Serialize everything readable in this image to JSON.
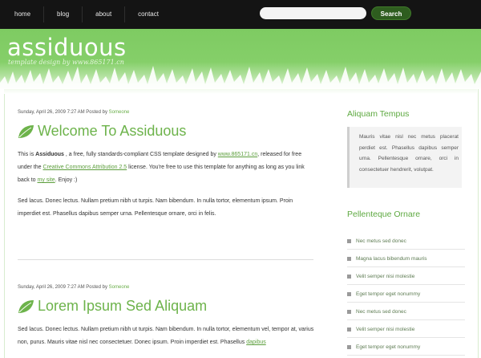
{
  "nav": {
    "items": [
      "home",
      "blog",
      "about",
      "contact"
    ]
  },
  "search": {
    "value": "",
    "button_label": "Search"
  },
  "header": {
    "title": "assiduous",
    "tagline": "template design by www.865171.cn"
  },
  "posts": [
    {
      "date": "Sunday, April 26, 2009 7:27 AM",
      "posted_by_label": "Posted by",
      "author": "Someone",
      "title": "Welcome To Assiduous",
      "p1": {
        "t1": "This is ",
        "bold": "Assiduous",
        "t2": " , a free, fully standards-compliant CSS template designed by ",
        "link1": "www.865171.cn",
        "t3": ", released for free under the ",
        "link2": "Creative Commons Attribution 2.5",
        "t4": " license. You're free to use this template for anything as long as you link back to ",
        "link3": "my site",
        "t5": ". Enjoy :)"
      },
      "p2": "Sed lacus. Donec lectus. Nullam pretium nibh ut turpis. Nam bibendum. In nulla tortor, elementum ipsum. Proin imperdiet est. Phasellus dapibus semper urna. Pellentesque ornare, orci in felis."
    },
    {
      "date": "Sunday, April 26, 2009 7:27 AM",
      "posted_by_label": "Posted by",
      "author": "Someone",
      "title": "Lorem Ipsum Sed Aliquam",
      "p1_text": "Sed lacus. Donec lectus. Nullam pretium nibh ut turpis. Nam bibendum. In nulla tortor, elementum vel, tempor at, varius non, purus. Mauris vitae nisl nec consectetuer. Donec ipsum. Proin imperdiet est. Phasellus ",
      "p1_link": "dapibus"
    }
  ],
  "sidebar": {
    "box1": {
      "title": "Aliquam Tempus",
      "text": "Mauris vitae nisl nec metus placerat perdiet est. Phasellus dapibus semper urna. Pellentesque ornare, orci in consectetuer hendrerit, volutpat."
    },
    "box2": {
      "title": "Pellenteque Ornare",
      "items": [
        "Nec metus sed donec",
        "Magna lacus bibendum mauris",
        "Velit semper nisi molestie",
        "Eget tempor eget nonummy",
        "Nec metus sed donec",
        "Velit semper nisi molestie",
        "Eget tempor eget nonummy"
      ]
    }
  },
  "colors": {
    "header_green": "#7ecb62",
    "title_green": "#6db34b",
    "topbar": "#141414",
    "search_button": "#2e5d1f"
  }
}
